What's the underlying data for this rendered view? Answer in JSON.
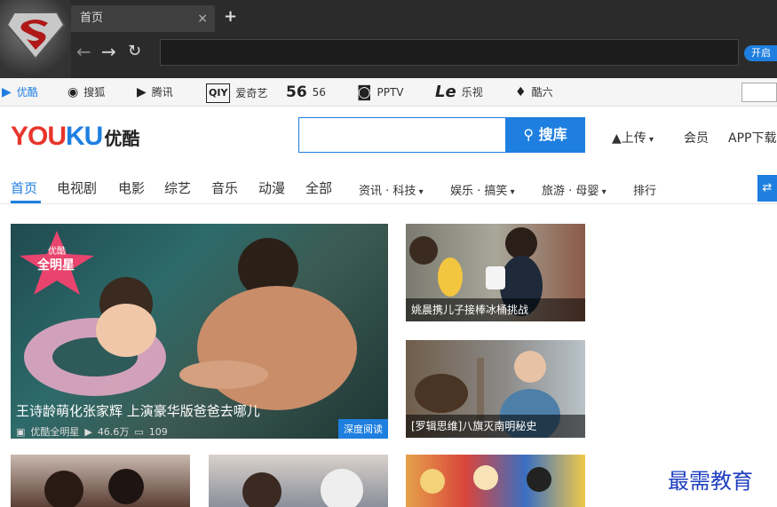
{
  "browser": {
    "tab_title": "首页",
    "tab_close": "×",
    "new_tab": "+",
    "back": "←",
    "forward": "→",
    "reload": "↻",
    "open_pill": "开启"
  },
  "bookmarks": [
    {
      "icon": "youku-icon",
      "label": "优酷",
      "glyph": "▶"
    },
    {
      "icon": "sohu-icon",
      "label": "搜狐",
      "glyph": "◉"
    },
    {
      "icon": "tencent-icon",
      "label": "腾讯",
      "glyph": "▶"
    },
    {
      "icon": "iqiyi-icon",
      "label": "爱奇艺",
      "glyph": "QIY"
    },
    {
      "icon": "56-icon",
      "label": "56",
      "glyph": "56"
    },
    {
      "icon": "pptv-icon",
      "label": "PPTV",
      "glyph": "◙"
    },
    {
      "icon": "letv-icon",
      "label": "乐视",
      "glyph": "Le"
    },
    {
      "icon": "ku6-icon",
      "label": "酷六",
      "glyph": "♦"
    }
  ],
  "header": {
    "logo_part1": "YOU",
    "logo_part2": "KU",
    "logo_cn": "优酷",
    "search_button": "搜库",
    "upload": "上传",
    "member": "会员",
    "app_download": "APP下载"
  },
  "nav": {
    "items": [
      "首页",
      "电视剧",
      "电影",
      "综艺",
      "音乐",
      "动漫",
      "全部"
    ],
    "dropdowns": [
      "资讯 · 科技",
      "娱乐 · 搞笑",
      "旅游 · 母婴"
    ],
    "rank": "排行"
  },
  "feature": {
    "star_badge_top": "优酷",
    "star_badge": "全明星",
    "title": "王诗龄萌化张家辉 上演豪华版爸爸去哪儿",
    "channel": "优酷全明星",
    "views": "46.6万",
    "comments": "109",
    "tag": "深度阅读"
  },
  "side_tiles": [
    {
      "caption": "姚晨携儿子接棒冰桶挑战"
    },
    {
      "caption": "[罗辑思维]八旗灭南明秘史"
    }
  ],
  "watermark": "最需教育",
  "colors": {
    "accent": "#1e7fe0",
    "brand_red": "#e8352c"
  }
}
